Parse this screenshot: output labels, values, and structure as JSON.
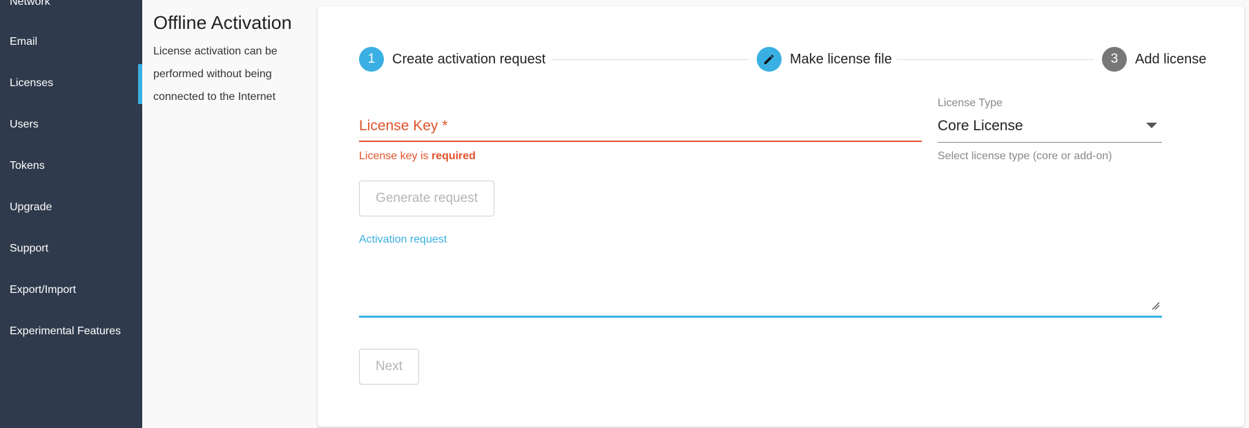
{
  "sidebar": {
    "items": [
      {
        "label": "Network"
      },
      {
        "label": "Email"
      },
      {
        "label": "Licenses"
      },
      {
        "label": "Users"
      },
      {
        "label": "Tokens"
      },
      {
        "label": "Upgrade"
      },
      {
        "label": "Support"
      },
      {
        "label": "Export/Import"
      },
      {
        "label": "Experimental Features"
      }
    ],
    "active_item": "Licenses"
  },
  "info": {
    "title": "Offline Activation",
    "description": "License activation can be performed without being connected to the Internet"
  },
  "stepper": {
    "steps": [
      {
        "number": "1",
        "label": "Create activation request",
        "state": "active"
      },
      {
        "number": "",
        "label": "Make license file",
        "state": "editing",
        "icon": "pencil-icon"
      },
      {
        "number": "3",
        "label": "Add license",
        "state": "inactive"
      }
    ]
  },
  "form": {
    "license_key": {
      "label": "License Key *",
      "value": "",
      "error_prefix": "License key is ",
      "error_emphasis": "required"
    },
    "license_type": {
      "label": "License Type",
      "value": "Core License",
      "helper": "Select license type (core or add-on)"
    },
    "generate_button": "Generate request",
    "activation_request": {
      "label": "Activation request",
      "value": ""
    },
    "next_button": "Next"
  },
  "colors": {
    "sidebar_bg": "#2f3a4c",
    "accent": "#3aafe3",
    "error": "#e2532b",
    "step_inactive": "#777777"
  }
}
